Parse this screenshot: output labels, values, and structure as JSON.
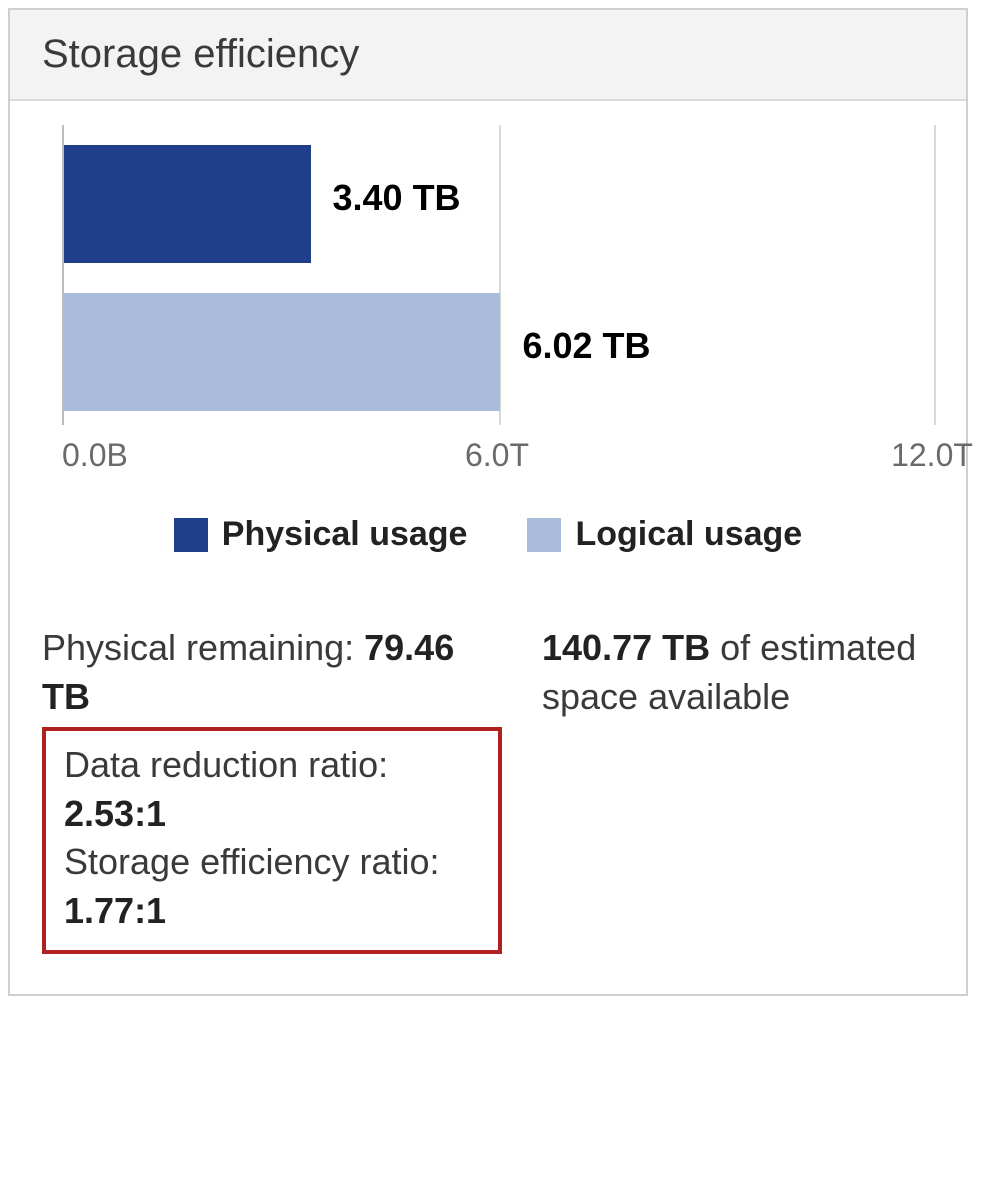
{
  "header": {
    "title": "Storage efficiency"
  },
  "chart_data": {
    "type": "bar",
    "orientation": "horizontal",
    "x_axis_max": 12,
    "ticks": [
      "0.0B",
      "6.0T",
      "12.0T"
    ],
    "series": [
      {
        "name": "Physical usage",
        "value_tb": 3.4,
        "label": "3.40 TB",
        "color": "#1f3f8a"
      },
      {
        "name": "Logical usage",
        "value_tb": 6.02,
        "label": "6.02 TB",
        "color": "#a9bcd9"
      }
    ]
  },
  "legend": {
    "physical": "Physical usage",
    "logical": "Logical usage"
  },
  "stats": {
    "physical_remaining_label": "Physical remaining: ",
    "physical_remaining_value": "79.46 TB",
    "estimated_space_value": "140.77 TB",
    "estimated_space_suffix": " of estimated space available",
    "data_reduction_label": "Data reduction ratio:",
    "data_reduction_value": "2.53:1",
    "storage_efficiency_label": "Storage efficiency ratio:",
    "storage_efficiency_value": "1.77:1"
  }
}
